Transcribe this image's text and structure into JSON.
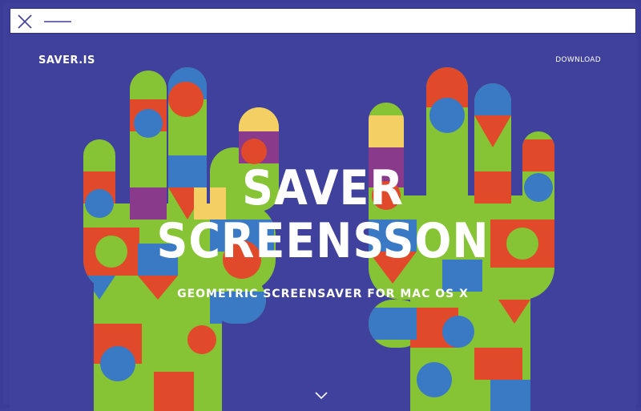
{
  "window": {
    "close_icon": "close-icon",
    "minimize_icon": "minimize-icon"
  },
  "nav": {
    "logo": "SAVER.IS",
    "download_label": "DOWNLOAD"
  },
  "hero": {
    "title_line1": "SAVER",
    "title_line2": "SCREENSSON",
    "subtitle": "GEOMETRIC SCREENSAVER FOR MAC OS X",
    "scroll_icon": "chevron-down-icon"
  },
  "colors": {
    "background": "#3f419c",
    "hand_green": "#86c436",
    "accent_red": "#e04a2a",
    "accent_blue": "#3a79c4",
    "accent_yellow": "#f4d064",
    "accent_purple": "#8a3a8a"
  }
}
